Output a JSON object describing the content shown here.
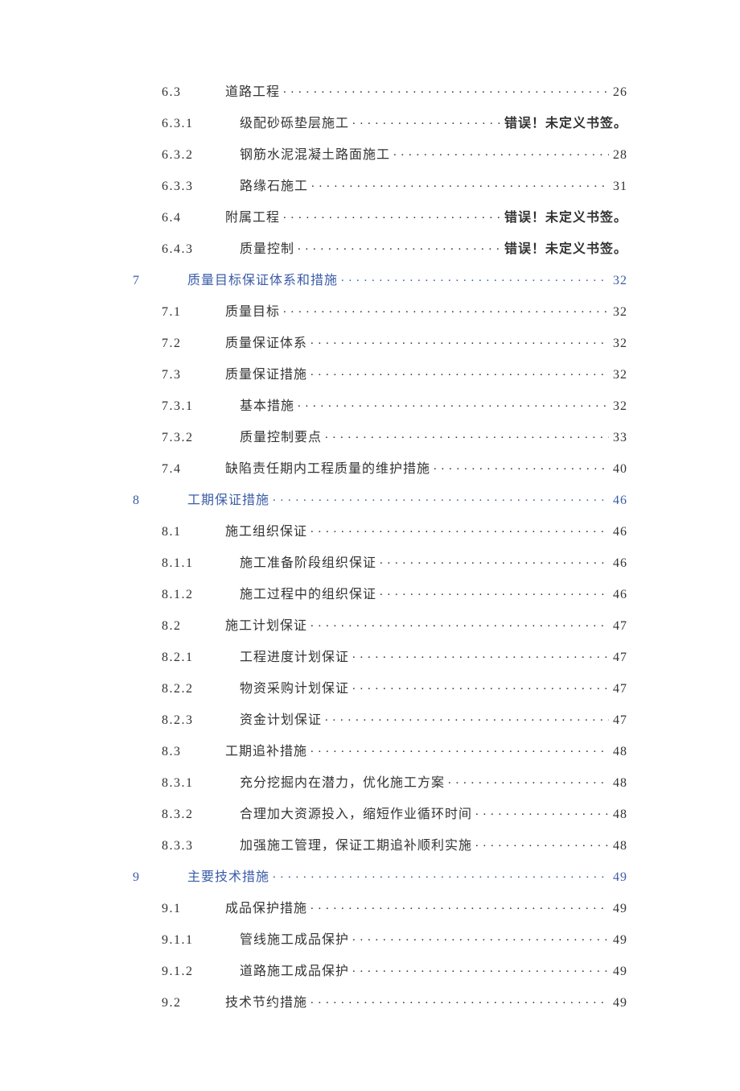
{
  "error_bookmark": "错误！未定义书签。",
  "toc": [
    {
      "level": 1,
      "num": "6.3",
      "title": "道路工程",
      "page": "26"
    },
    {
      "level": 2,
      "num": "6.3.1",
      "title": "级配砂砾垫层施工",
      "page_error": true
    },
    {
      "level": 2,
      "num": "6.3.2",
      "title": "钢筋水泥混凝土路面施工",
      "page": "28"
    },
    {
      "level": 2,
      "num": "6.3.3",
      "title": "路缘石施工",
      "page": "31"
    },
    {
      "level": 1,
      "num": "6.4",
      "title": "附属工程",
      "page_error": true
    },
    {
      "level": 2,
      "num": "6.4.3",
      "title": "质量控制",
      "page_error": true
    },
    {
      "level": 0,
      "num": "7",
      "title": "质量目标保证体系和措施",
      "page": "32"
    },
    {
      "level": 1,
      "num": "7.1",
      "title": "质量目标",
      "page": "32"
    },
    {
      "level": 1,
      "num": "7.2",
      "title": "质量保证体系",
      "page": "32"
    },
    {
      "level": 1,
      "num": "7.3",
      "title": "质量保证措施",
      "page": "32"
    },
    {
      "level": 2,
      "num": "7.3.1",
      "title": "基本措施",
      "page": "32"
    },
    {
      "level": 2,
      "num": "7.3.2",
      "title": "质量控制要点",
      "page": "33"
    },
    {
      "level": 1,
      "num": "7.4",
      "title": "缺陷责任期内工程质量的维护措施",
      "page": "40"
    },
    {
      "level": 0,
      "num": "8",
      "title": "工期保证措施",
      "page": "46"
    },
    {
      "level": 1,
      "num": "8.1",
      "title": "施工组织保证",
      "page": "46"
    },
    {
      "level": 2,
      "num": "8.1.1",
      "title": "施工准备阶段组织保证",
      "page": "46"
    },
    {
      "level": 2,
      "num": "8.1.2",
      "title": "施工过程中的组织保证",
      "page": "46"
    },
    {
      "level": 1,
      "num": "8.2",
      "title": "施工计划保证",
      "page": "47"
    },
    {
      "level": 2,
      "num": "8.2.1",
      "title": "工程进度计划保证",
      "page": "47"
    },
    {
      "level": 2,
      "num": "8.2.2",
      "title": "物资采购计划保证",
      "page": "47"
    },
    {
      "level": 2,
      "num": "8.2.3",
      "title": "资金计划保证",
      "page": "47"
    },
    {
      "level": 1,
      "num": "8.3",
      "title": "工期追补措施",
      "page": "48"
    },
    {
      "level": 2,
      "num": "8.3.1",
      "title": "充分挖掘内在潜力，优化施工方案",
      "page": "48"
    },
    {
      "level": 2,
      "num": "8.3.2",
      "title": "合理加大资源投入，缩短作业循环时间",
      "page": "48"
    },
    {
      "level": 2,
      "num": "8.3.3",
      "title": "加强施工管理，保证工期追补顺利实施",
      "page": "48"
    },
    {
      "level": 0,
      "num": "9",
      "title": "主要技术措施",
      "page": "49"
    },
    {
      "level": 1,
      "num": "9.1",
      "title": "成品保护措施",
      "page": "49"
    },
    {
      "level": 2,
      "num": "9.1.1",
      "title": "管线施工成品保护",
      "page": "49"
    },
    {
      "level": 2,
      "num": "9.1.2",
      "title": "道路施工成品保护",
      "page": "49"
    },
    {
      "level": 1,
      "num": "9.2",
      "title": "技术节约措施",
      "page": "49"
    }
  ]
}
